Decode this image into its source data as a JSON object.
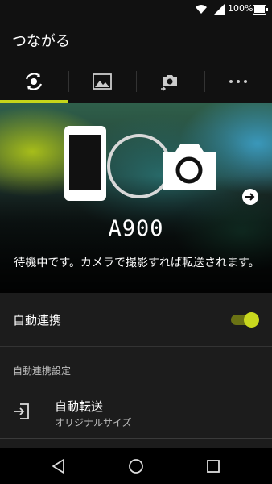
{
  "status_bar": {
    "battery_percent": "100%",
    "icons": [
      "wifi-icon",
      "signal-icon",
      "battery-icon"
    ]
  },
  "app_bar": {
    "title": "つながる"
  },
  "tabs": [
    {
      "name": "connect",
      "icon": "connection-sync-icon",
      "active": true
    },
    {
      "name": "photos",
      "icon": "image-gallery-icon",
      "active": false
    },
    {
      "name": "remote",
      "icon": "camera-transfer-icon",
      "active": false
    },
    {
      "name": "more",
      "icon": "more-dots-icon",
      "active": false
    }
  ],
  "hero": {
    "device_name": "A900",
    "status_message": "待機中です。カメラで撮影すれば転送されます。"
  },
  "settings": {
    "auto_link_label": "自動連携",
    "auto_link_enabled": true,
    "section_header": "自動連携設定",
    "auto_transfer_title": "自動転送",
    "auto_transfer_value": "オリジナルサイズ"
  },
  "nav_bar": {
    "buttons": [
      "back-icon",
      "home-icon",
      "recents-icon"
    ]
  },
  "colors": {
    "accent": "#c6d51a",
    "toggle_track": "#6a7214",
    "background": "#1c1c1c"
  }
}
